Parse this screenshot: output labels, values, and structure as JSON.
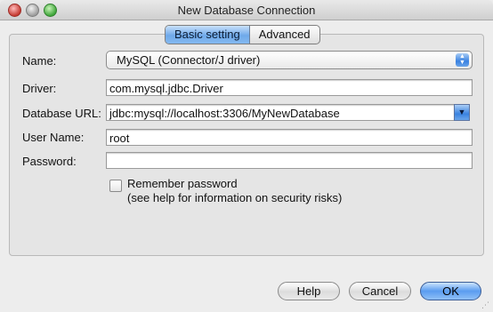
{
  "window": {
    "title": "New Database Connection"
  },
  "tabs": [
    {
      "label": "Basic setting",
      "active": true
    },
    {
      "label": "Advanced",
      "active": false
    }
  ],
  "form": {
    "name": {
      "label": "Name:",
      "value": "MySQL (Connector/J driver)"
    },
    "driver": {
      "label": "Driver:",
      "value": "com.mysql.jdbc.Driver"
    },
    "url": {
      "label": "Database URL:",
      "value": "jdbc:mysql://localhost:3306/MyNewDatabase"
    },
    "user": {
      "label": "User Name:",
      "value": "root"
    },
    "password": {
      "label": "Password:",
      "value": ""
    },
    "remember": {
      "label_line1": "Remember password",
      "label_line2": "(see help for information on security risks)",
      "checked": false
    }
  },
  "buttons": {
    "help": "Help",
    "cancel": "Cancel",
    "ok": "OK"
  },
  "icons": {
    "close": "close-icon",
    "minimize": "minimize-icon",
    "zoom": "zoom-icon",
    "popup_arrows": "up-down-arrows-icon",
    "combo_arrow": "chevron-down-icon"
  },
  "colors": {
    "accent": "#5a9cf0",
    "close": "#c53b32",
    "minimize": "#9d9d9d",
    "zoom": "#3fa63a"
  }
}
